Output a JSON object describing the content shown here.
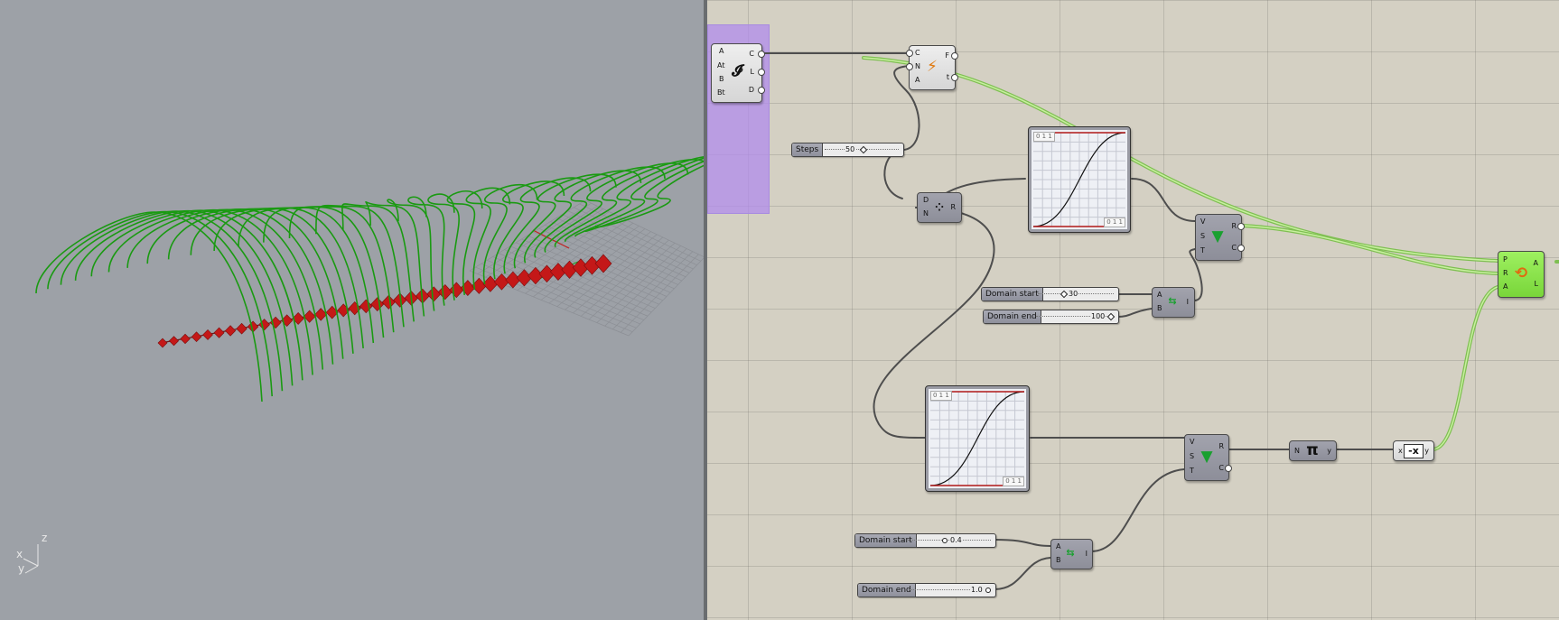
{
  "viewport": {
    "axes": {
      "x": "x",
      "y": "y",
      "z": "z"
    }
  },
  "canvas": {
    "components": {
      "loft": {
        "inputs": [
          "A",
          "At",
          "B",
          "Bt"
        ],
        "outputs": [
          "C",
          "L",
          "D"
        ],
        "icon": "tween-curve-icon"
      },
      "divide": {
        "inputs": [
          "C",
          "N",
          "A"
        ],
        "outputs": [
          "F",
          "t"
        ],
        "icon": "divide-curve-icon"
      },
      "range": {
        "inputs": [
          "D",
          "N"
        ],
        "outputs": [
          "R"
        ],
        "icon": "range-icon"
      },
      "remap_top": {
        "inputs": [
          "V",
          "S",
          "T"
        ],
        "outputs": [
          "R",
          "C"
        ],
        "icon": "remap-icon"
      },
      "bounds_top": {
        "inputs": [
          "A",
          "B"
        ],
        "outputs": [
          "I"
        ],
        "icon": "construct-domain-icon"
      },
      "remap_bottom": {
        "inputs": [
          "V",
          "S",
          "T"
        ],
        "outputs": [
          "R",
          "C"
        ],
        "icon": "remap-icon"
      },
      "pi": {
        "inputs": [
          "N"
        ],
        "outputs": [
          "y"
        ],
        "icon_text": "π"
      },
      "negative": {
        "inputs": [
          "x"
        ],
        "outputs": [
          "y"
        ],
        "icon_text": "-x"
      },
      "bounds_bottom": {
        "inputs": [
          "A",
          "B"
        ],
        "outputs": [
          "I"
        ],
        "icon": "construct-domain-icon"
      },
      "rotate": {
        "inputs": [
          "P",
          "R",
          "A"
        ],
        "outputs": [
          "A",
          "L"
        ],
        "icon": "rotate-icon"
      }
    },
    "sliders": {
      "steps": {
        "label": "Steps",
        "value": "50"
      },
      "domain_start_1": {
        "label": "Domain start",
        "value": "30"
      },
      "domain_end_1": {
        "label": "Domain end",
        "value": "100"
      },
      "domain_start_2": {
        "label": "Domain start",
        "value": "0.4"
      },
      "domain_end_2": {
        "label": "Domain end",
        "value": "1.0"
      }
    },
    "graphs": {
      "top": {
        "tl": "0 1 1",
        "br": "0 1 1"
      },
      "bottom": {
        "tl": "0 1 1",
        "br": "0 1 1"
      }
    }
  },
  "colors": {
    "viewport_bg": "#9da1a7",
    "canvas_bg": "#d4d0c3",
    "group": "#b28cec",
    "curves": "#1a9a12",
    "planes": "#c41818",
    "wire": "#555555",
    "wire_selected": "#8fd45a"
  }
}
